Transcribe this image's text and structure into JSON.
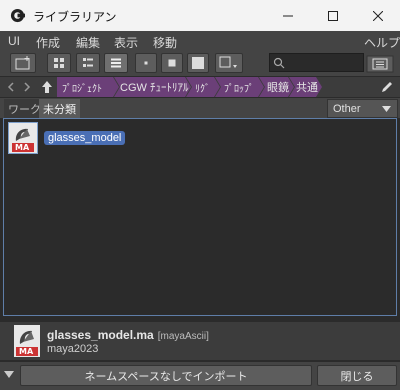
{
  "window": {
    "title": "ライブラリアン",
    "minimize_glyph": "—",
    "maximize_glyph": "☐",
    "close_glyph": "✕"
  },
  "menu": {
    "items": [
      "UI",
      "作成",
      "編集",
      "表示",
      "移動"
    ],
    "help": "ヘルプ"
  },
  "toolbar": {
    "search_placeholder": "",
    "search_icon": "search-icon"
  },
  "breadcrumb": {
    "items": [
      {
        "label": "ﾌﾟﾛｼﾞｪｸﾄ",
        "color": "#6b3f78"
      },
      {
        "label": "CGW ﾁｭｰﾄﾘｱﾙ",
        "color": "#6b3f78"
      },
      {
        "label": "ﾘｸﾞ",
        "color": "#6b3f78"
      },
      {
        "label": "ﾌﾟﾛｯﾌﾟ",
        "color": "#6b3f78"
      },
      {
        "label": "眼鏡",
        "color": "#6b3f78"
      },
      {
        "label": "共通",
        "color": "#6b3f78"
      }
    ]
  },
  "tabs": [
    {
      "label": "ワーク",
      "active": false
    },
    {
      "label": "未分類",
      "active": true
    }
  ],
  "filter": {
    "selected": "Other"
  },
  "files": [
    {
      "name": "glasses_model",
      "icon_label": "MA"
    }
  ],
  "info": {
    "filename": "glasses_model.ma",
    "filetype": "[mayaAscii]",
    "version": "maya2023",
    "icon_label": "MA"
  },
  "buttons": {
    "import_no_namespace": "ネームスペースなしでインポート",
    "close": "閉じる"
  },
  "colors": {
    "accent": "#4a6fb5",
    "breadcrumb": "#6b3f78"
  }
}
